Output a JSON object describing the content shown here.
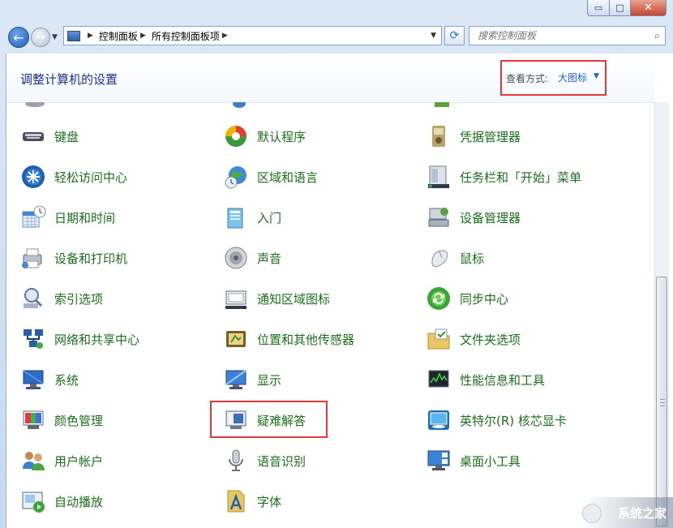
{
  "window": {
    "caption_buttons": {
      "minimize": "▭",
      "maximize": "□",
      "close": "✕"
    }
  },
  "nav": {
    "breadcrumb": [
      "控制面板",
      "所有控制面板项"
    ],
    "search_placeholder": "搜索控制面板"
  },
  "header": {
    "title": "调整计算机的设置",
    "view_by_label": "查看方式:",
    "view_by_value": "大图标"
  },
  "items": [
    {
      "label": "键盘",
      "icon": "keyboard-icon"
    },
    {
      "label": "默认程序",
      "icon": "default-programs-icon"
    },
    {
      "label": "凭据管理器",
      "icon": "credential-manager-icon"
    },
    {
      "label": "轻松访问中心",
      "icon": "ease-of-access-icon"
    },
    {
      "label": "区域和语言",
      "icon": "region-language-icon"
    },
    {
      "label": "任务栏和「开始」菜单",
      "icon": "taskbar-start-menu-icon"
    },
    {
      "label": "日期和时间",
      "icon": "date-time-icon"
    },
    {
      "label": "入门",
      "icon": "getting-started-icon"
    },
    {
      "label": "设备管理器",
      "icon": "device-manager-icon"
    },
    {
      "label": "设备和打印机",
      "icon": "devices-printers-icon"
    },
    {
      "label": "声音",
      "icon": "sound-icon"
    },
    {
      "label": "鼠标",
      "icon": "mouse-icon"
    },
    {
      "label": "索引选项",
      "icon": "indexing-options-icon"
    },
    {
      "label": "通知区域图标",
      "icon": "notification-area-icon"
    },
    {
      "label": "同步中心",
      "icon": "sync-center-icon"
    },
    {
      "label": "网络和共享中心",
      "icon": "network-sharing-icon"
    },
    {
      "label": "位置和其他传感器",
      "icon": "location-sensors-icon"
    },
    {
      "label": "文件夹选项",
      "icon": "folder-options-icon"
    },
    {
      "label": "系统",
      "icon": "system-icon"
    },
    {
      "label": "显示",
      "icon": "display-icon"
    },
    {
      "label": "性能信息和工具",
      "icon": "performance-icon"
    },
    {
      "label": "颜色管理",
      "icon": "color-management-icon"
    },
    {
      "label": "疑难解答",
      "icon": "troubleshooting-icon"
    },
    {
      "label": "英特尔(R) 核芯显卡",
      "icon": "intel-graphics-icon"
    },
    {
      "label": "用户帐户",
      "icon": "user-accounts-icon"
    },
    {
      "label": "语音识别",
      "icon": "speech-recognition-icon"
    },
    {
      "label": "桌面小工具",
      "icon": "desktop-gadgets-icon"
    },
    {
      "label": "自动播放",
      "icon": "autoplay-icon"
    },
    {
      "label": "字体",
      "icon": "fonts-icon"
    }
  ],
  "watermark": {
    "text": "系统之家"
  },
  "colors": {
    "accent": "#1a64c2",
    "item_text": "#1c6e1c",
    "title": "#1e3287",
    "highlight": "#e53737"
  }
}
